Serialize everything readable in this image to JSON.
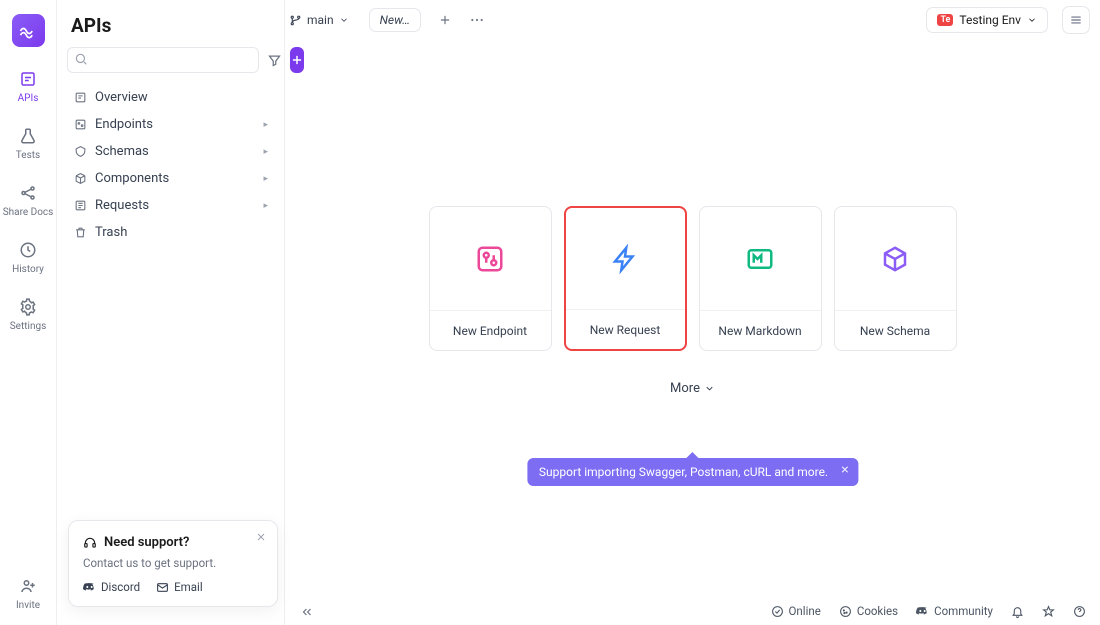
{
  "rail": {
    "items": [
      {
        "label": "APIs",
        "active": true
      },
      {
        "label": "Tests"
      },
      {
        "label": "Share Docs"
      },
      {
        "label": "History"
      },
      {
        "label": "Settings"
      }
    ],
    "invite_label": "Invite"
  },
  "panel": {
    "title": "APIs",
    "search_placeholder": "",
    "tree": [
      {
        "label": "Overview",
        "expandable": false
      },
      {
        "label": "Endpoints",
        "expandable": true
      },
      {
        "label": "Schemas",
        "expandable": true
      },
      {
        "label": "Components",
        "expandable": true
      },
      {
        "label": "Requests",
        "expandable": true
      },
      {
        "label": "Trash",
        "expandable": false
      }
    ]
  },
  "topbar": {
    "branch_label": "main",
    "tab_label": "New…",
    "env_badge": "Te",
    "env_label": "Testing Env"
  },
  "content": {
    "cards": [
      {
        "label": "New Endpoint",
        "selected": false,
        "icon_color": "#ec4899"
      },
      {
        "label": "New Request",
        "selected": true,
        "icon_color": "#3b82f6"
      },
      {
        "label": "New Markdown",
        "selected": false,
        "icon_color": "#10b981"
      },
      {
        "label": "New Schema",
        "selected": false,
        "icon_color": "#8b5cf6"
      }
    ],
    "more_label": "More"
  },
  "tooltip": {
    "text": "Support importing Swagger, Postman, cURL and more."
  },
  "support": {
    "title": "Need support?",
    "subtitle": "Contact us to get support.",
    "discord_label": "Discord",
    "email_label": "Email"
  },
  "statusbar": {
    "online_label": "Online",
    "cookies_label": "Cookies",
    "community_label": "Community"
  }
}
